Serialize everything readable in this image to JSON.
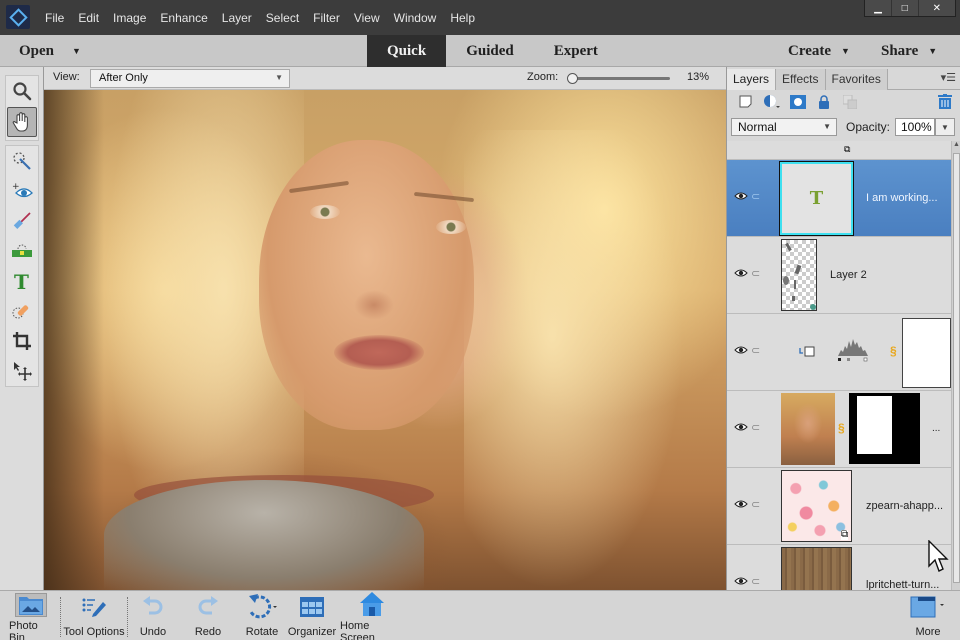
{
  "menubar": {
    "items": [
      "File",
      "Edit",
      "Image",
      "Enhance",
      "Layer",
      "Select",
      "Filter",
      "View",
      "Window",
      "Help"
    ],
    "window_controls": {
      "minimize": "▁",
      "maximize": "□",
      "close": "✕"
    }
  },
  "modebar": {
    "open_label": "Open",
    "tabs": [
      {
        "label": "Quick",
        "active": true
      },
      {
        "label": "Guided",
        "active": false
      },
      {
        "label": "Expert",
        "active": false
      }
    ],
    "create_label": "Create",
    "share_label": "Share"
  },
  "options": {
    "view_label": "View:",
    "view_value": "After Only",
    "zoom_label": "Zoom:",
    "zoom_value": "13%",
    "zoom_percent": 13
  },
  "toolbox": {
    "tools": [
      {
        "name": "zoom-tool",
        "icon": "magnifier-icon"
      },
      {
        "name": "hand-tool",
        "icon": "hand-icon",
        "selected": true
      },
      {
        "name": "quick-selection-tool",
        "icon": "magic-wand-selection-icon"
      },
      {
        "name": "red-eye-tool",
        "icon": "eye-icon"
      },
      {
        "name": "whiten-teeth-tool",
        "icon": "brush-icon"
      },
      {
        "name": "straighten-tool",
        "icon": "level-icon"
      },
      {
        "name": "type-tool",
        "icon": "type-icon"
      },
      {
        "name": "spot-healing-tool",
        "icon": "bandage-icon"
      },
      {
        "name": "crop-tool",
        "icon": "crop-icon"
      },
      {
        "name": "move-tool",
        "icon": "move-icon"
      }
    ]
  },
  "panel": {
    "tabs": [
      {
        "label": "Layers",
        "active": true
      },
      {
        "label": "Effects",
        "active": false
      },
      {
        "label": "Favorites",
        "active": false
      }
    ],
    "blend_mode": "Normal",
    "opacity_label": "Opacity:",
    "opacity_value": "100%",
    "layers": [
      {
        "name": "",
        "type": "smart-object-partial"
      },
      {
        "name": "I am working...",
        "type": "text",
        "selected": true,
        "glyph": "T"
      },
      {
        "name": "Layer 2",
        "type": "pixel"
      },
      {
        "name": "",
        "type": "levels-adjustment"
      },
      {
        "name": "",
        "type": "photo-with-mask",
        "extra": "..."
      },
      {
        "name": "zpearn-ahapp...",
        "type": "smart-object"
      },
      {
        "name": "lpritchett-turn...",
        "type": "pixel"
      }
    ]
  },
  "bottombar": {
    "items": [
      {
        "label": "Photo Bin",
        "icon": "photo-bin-icon",
        "selected": true
      },
      {
        "label": "Tool Options",
        "icon": "tool-options-icon"
      },
      {
        "label": "Undo",
        "icon": "undo-icon"
      },
      {
        "label": "Redo",
        "icon": "redo-icon"
      },
      {
        "label": "Rotate",
        "icon": "rotate-icon"
      },
      {
        "label": "Organizer",
        "icon": "organizer-icon"
      },
      {
        "label": "Home Screen",
        "icon": "home-icon"
      },
      {
        "label": "More",
        "icon": "more-panels-icon"
      }
    ]
  },
  "colors": {
    "menubar_bg": "#3c3c3c",
    "active_tab_bg": "#2e2e2e",
    "selected_layer": "#4f86c6",
    "accent_blue": "#2a8ad8"
  }
}
